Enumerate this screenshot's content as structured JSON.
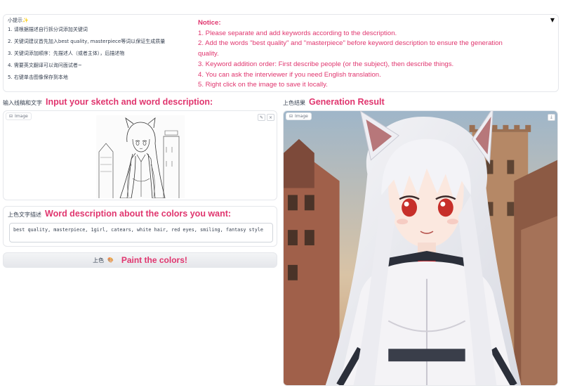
{
  "tips": {
    "cn_title": "小提示✨",
    "cn_items": [
      "1. 请根据描述自行拆分词添加关键词",
      "2. 关键词建议首先加入best quality, masterpiece等词以保证生成质量",
      "3. 关键词添加顺序：先描述人（或者主体），后描述物",
      "4. 需要英文翻译可以询问面试者~",
      "5. 右键单击图像保存到本地"
    ],
    "en_title": "Notice:",
    "en_items": [
      "1. Please separate and add keywords according to the description.",
      "2. Add the words \"best quality\" and \"masterpiece\" before keyword description to ensure the generation quality.",
      "3. Keyword addition order: First describe people (or the subject), then describe things.",
      "4. You can ask the interviewer if you need English translation.",
      "5. Right click on the image to save it locally."
    ],
    "collapse_icon": "▼"
  },
  "input": {
    "label_cn": "输入线稿和文字",
    "label_en": "Input your sketch and word description:",
    "image_tag": "Image",
    "tag_icon": "⊟",
    "edit_icon": "✎",
    "clear_icon": "×"
  },
  "description": {
    "label_cn": "上色文字描述",
    "label_en": "Word description about the colors you want:",
    "value": "best quality, masterpiece, 1girl, catears, white hair, red eyes, smiling, fantasy style"
  },
  "paint_button": {
    "label_cn": "上色",
    "emoji": "🎨",
    "label_en": "Paint the colors!"
  },
  "output": {
    "label_cn": "上色结果",
    "label_en": "Generation Result",
    "image_tag": "Image",
    "tag_icon": "⊟",
    "download_icon": "⤓"
  },
  "colors": {
    "accent": "#e0356e",
    "border": "#e5e7eb",
    "text": "#374151"
  }
}
